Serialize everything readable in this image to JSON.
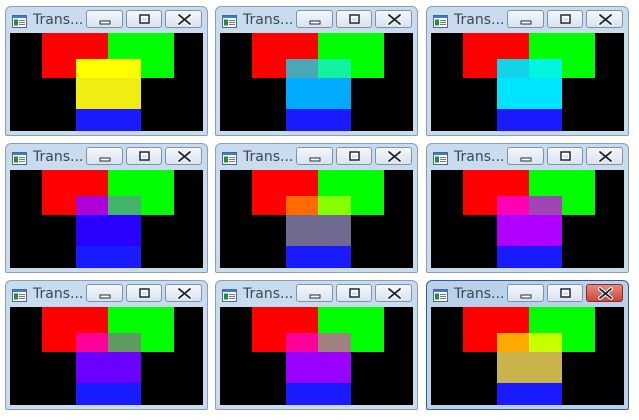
{
  "windows": [
    {
      "title": "Trans...",
      "active": false,
      "colors": {
        "overlay_top": "#ffff00",
        "overlay_mid": "#f0ee10",
        "overlay_bottom": "#1a1aff"
      }
    },
    {
      "title": "Trans...",
      "active": false,
      "colors": {
        "overlay_left": "#4aa8b6",
        "overlay_right": "#11f3a0",
        "overlay_mid": "#00aaff",
        "overlay_bottom": "#1a1aff"
      }
    },
    {
      "title": "Trans...",
      "active": false,
      "colors": {
        "overlay_left": "#12d4e8",
        "overlay_right": "#00f5e0",
        "overlay_mid": "#00e5ff",
        "overlay_bottom": "#1a1aff"
      }
    },
    {
      "title": "Trans...",
      "active": false,
      "colors": {
        "overlay_left": "#b000d8",
        "overlay_right": "#44b46c",
        "overlay_mid": "#2a00ff",
        "overlay_bottom": "#1a1aff"
      }
    },
    {
      "title": "Trans...",
      "active": false,
      "colors": {
        "overlay_left": "#ff6b00",
        "overlay_right": "#88ff00",
        "overlay_mid": "#6f6a8f",
        "overlay_bottom": "#1a1aff"
      }
    },
    {
      "title": "Trans...",
      "active": false,
      "colors": {
        "overlay_left": "#ff00b4",
        "overlay_right": "#a045b4",
        "overlay_mid": "#b000ff",
        "overlay_bottom": "#1a1aff"
      }
    },
    {
      "title": "Trans...",
      "active": false,
      "colors": {
        "overlay_left": "#ff0099",
        "overlay_right": "#5f9a60",
        "overlay_mid": "#6a00ff",
        "overlay_bottom": "#1a1aff"
      }
    },
    {
      "title": "Trans...",
      "active": false,
      "colors": {
        "overlay_left": "#ff0099",
        "overlay_right": "#a08080",
        "overlay_mid": "#9a00ff",
        "overlay_bottom": "#1a1aff"
      }
    },
    {
      "title": "Trans...",
      "active": true,
      "colors": {
        "overlay_left": "#ffaa00",
        "overlay_right": "#c8ff00",
        "overlay_mid": "#c8b44a",
        "overlay_bottom": "#1a1aff"
      }
    }
  ],
  "base_colors": {
    "red": "#ff0000",
    "green": "#00ff00",
    "background": "#000000"
  },
  "icons": {
    "app": "app-window-icon",
    "minimize": "minimize-icon",
    "maximize": "maximize-icon",
    "close": "close-icon"
  }
}
